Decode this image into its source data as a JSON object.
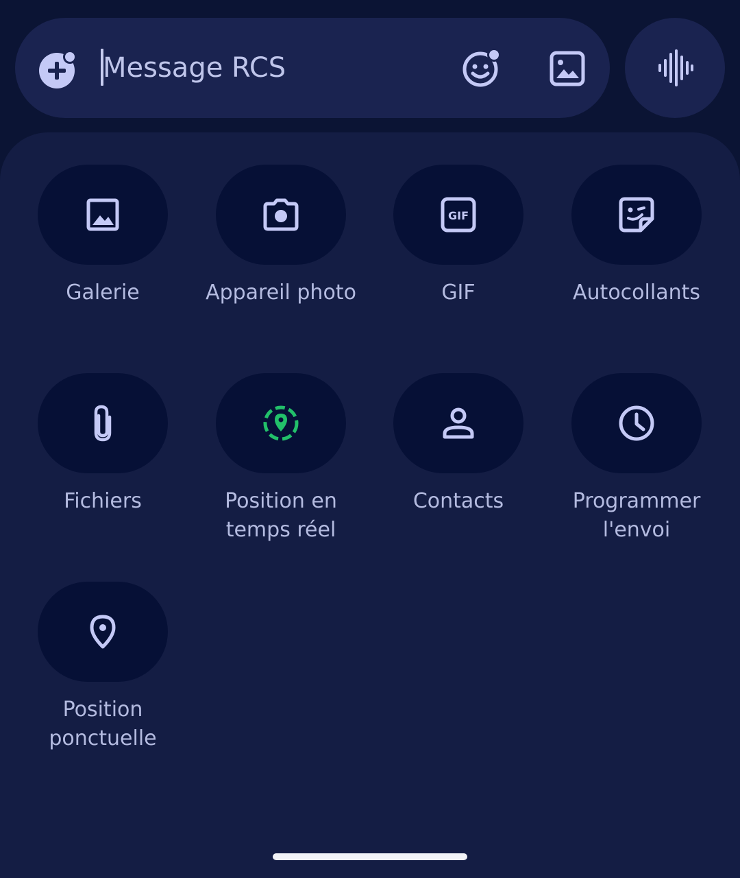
{
  "compose": {
    "placeholder": "Message RCS",
    "value": ""
  },
  "icons": {
    "add": "add-circle-icon",
    "emoji": "emoji-icon",
    "image": "image-icon",
    "voice": "voice-waveform-icon",
    "gallery": "gallery-icon",
    "camera": "camera-icon",
    "gif": "gif-icon",
    "sticker": "sticker-icon",
    "attachment": "paperclip-icon",
    "live_location": "live-location-icon",
    "contact": "person-icon",
    "schedule": "clock-icon",
    "location": "location-pin-icon"
  },
  "attachments": [
    {
      "label": "Galerie"
    },
    {
      "label": "Appareil photo"
    },
    {
      "label": "GIF"
    },
    {
      "label": "Autocollants"
    },
    {
      "label": "Fichiers"
    },
    {
      "label": "Position en\ntemps réel"
    },
    {
      "label": "Contacts"
    },
    {
      "label": "Programmer\nl'envoi"
    },
    {
      "label": "Position\nponctuelle"
    }
  ],
  "colors": {
    "background": "#0b1434",
    "panel": "#141d44",
    "tile": "#061036",
    "accent": "#c4c9f6",
    "live_location": "#22c06a"
  }
}
